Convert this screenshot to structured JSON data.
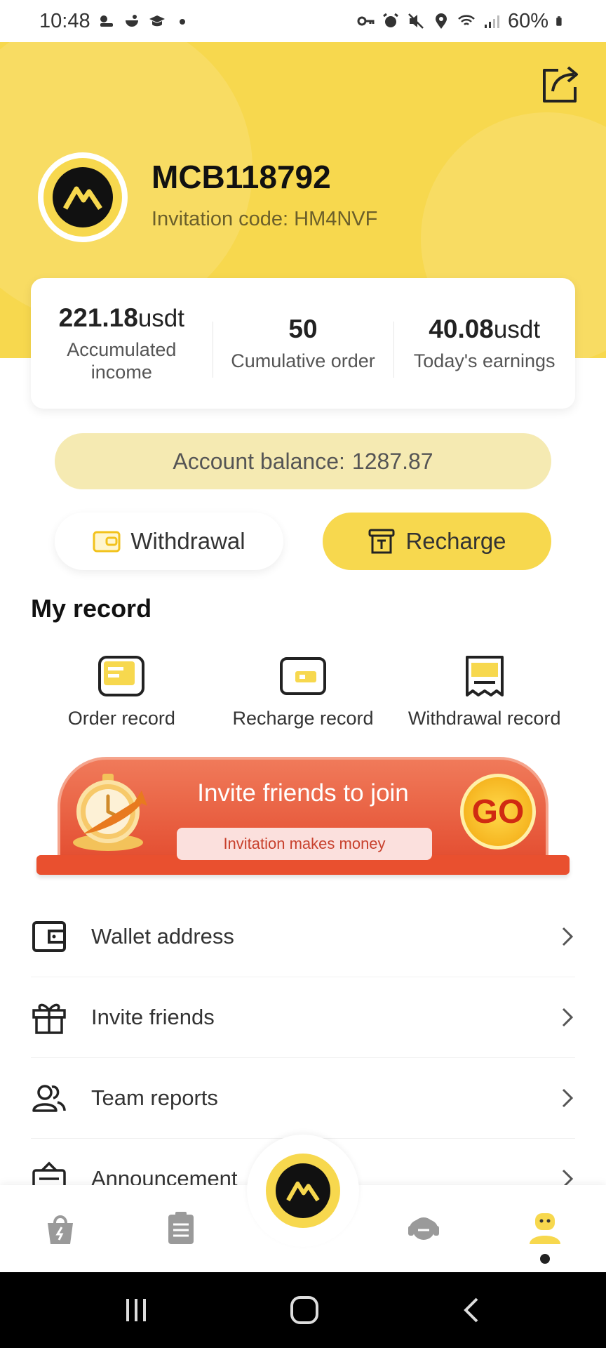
{
  "status_bar": {
    "time": "10:48",
    "battery": "60%"
  },
  "profile": {
    "username": "MCB118792",
    "invitation_label": "Invitation code:",
    "invitation_code": "HM4NVF"
  },
  "stats": [
    {
      "value": "221.18",
      "unit": "usdt",
      "label": "Accumulated income"
    },
    {
      "value": "50",
      "unit": "",
      "label": "Cumulative order"
    },
    {
      "value": "40.08",
      "unit": "usdt",
      "label": "Today's earnings"
    }
  ],
  "balance": {
    "label": "Account balance:",
    "value": "1287.87"
  },
  "actions": {
    "withdrawal": "Withdrawal",
    "recharge": "Recharge"
  },
  "my_record": {
    "title": "My record",
    "items": [
      {
        "label": "Order record",
        "icon": "order-record-icon"
      },
      {
        "label": "Recharge record",
        "icon": "recharge-record-icon"
      },
      {
        "label": "Withdrawal record",
        "icon": "withdrawal-record-icon"
      }
    ]
  },
  "banner": {
    "title": "Invite friends to join",
    "subtitle": "Invitation makes money",
    "go": "GO"
  },
  "menu": [
    {
      "label": "Wallet address",
      "icon": "wallet-icon"
    },
    {
      "label": "Invite friends",
      "icon": "gift-icon"
    },
    {
      "label": "Team reports",
      "icon": "team-icon"
    },
    {
      "label": "Announcement",
      "icon": "announcement-icon"
    }
  ],
  "colors": {
    "brand_yellow": "#f7d84e",
    "balance_bg": "#f5eab2",
    "banner_red": "#e34c2f"
  }
}
